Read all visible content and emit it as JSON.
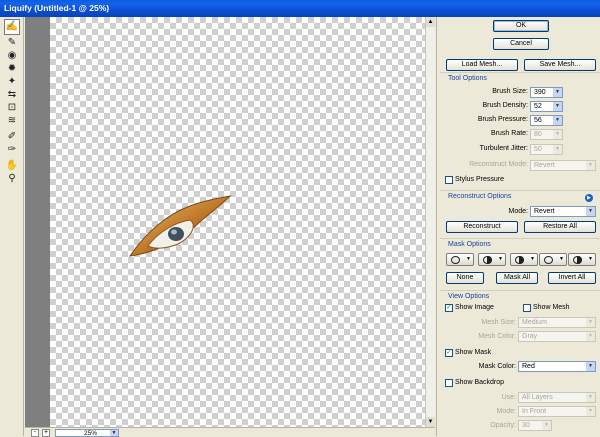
{
  "window": {
    "title": "Liquify (Untitled-1 @ 25%)"
  },
  "status": {
    "zoom": "25%",
    "zoom_minus": "-",
    "zoom_plus": "+"
  },
  "tools": [
    "warp-icon",
    "reconstruct-icon",
    "twirl-icon",
    "pucker-icon",
    "bloat-icon",
    "push-left-icon",
    "mirror-icon",
    "turbulence-icon",
    "freeze-mask-icon",
    "thaw-mask-icon",
    "hand-icon",
    "zoom-icon"
  ],
  "buttons": {
    "ok": "OK",
    "cancel": "Cancel",
    "load_mesh": "Load Mesh...",
    "save_mesh": "Save Mesh..."
  },
  "tool_options": {
    "title": "Tool Options",
    "brush_size_label": "Brush Size:",
    "brush_size": "390",
    "brush_density_label": "Brush Density:",
    "brush_density": "52",
    "brush_pressure_label": "Brush Pressure:",
    "brush_pressure": "56",
    "brush_rate_label": "Brush Rate:",
    "brush_rate": "80",
    "turbulent_jitter_label": "Turbulent Jitter:",
    "turbulent_jitter": "50",
    "reconstruct_mode_label": "Reconstruct Mode:",
    "reconstruct_mode": "Revert",
    "stylus_pressure": "Stylus Pressure"
  },
  "reconstruct_options": {
    "title": "Reconstruct Options",
    "mode_label": "Mode:",
    "mode": "Revert",
    "reconstruct": "Reconstruct",
    "restore_all": "Restore All"
  },
  "mask_options": {
    "title": "Mask Options",
    "none": "None",
    "mask_all": "Mask All",
    "invert_all": "Invert All"
  },
  "view_options": {
    "title": "View Options",
    "show_image": "Show Image",
    "show_mesh": "Show Mesh",
    "mesh_size_label": "Mesh Size:",
    "mesh_size": "Medium",
    "mesh_color_label": "Mesh Color:",
    "mesh_color": "Gray",
    "show_mask": "Show Mask",
    "mask_color_label": "Mask Color:",
    "mask_color": "Red",
    "show_backdrop": "Show Backdrop",
    "use_label": "Use:",
    "use": "All Layers",
    "mode_label": "Mode:",
    "mode": "In Front",
    "opacity_label": "Opacity:",
    "opacity": "30"
  },
  "checkmark": "✓",
  "dropdown_arrow": "▼"
}
